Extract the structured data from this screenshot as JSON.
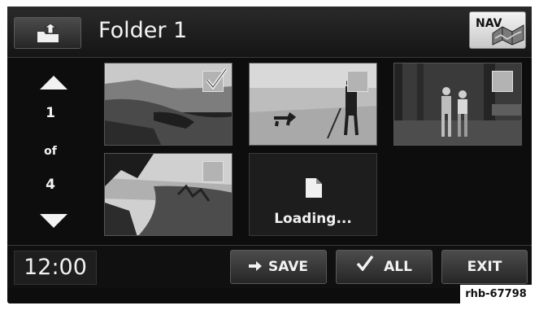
{
  "header": {
    "title": "Folder 1",
    "up_icon": "folder-up-icon",
    "nav_label": "NAV"
  },
  "pager": {
    "current": "1",
    "of": "of",
    "total": "4"
  },
  "thumbnails": [
    {
      "subject": "coastline landscape",
      "checked": true
    },
    {
      "subject": "person with dog on field",
      "checked": false
    },
    {
      "subject": "two people in forest",
      "checked": false
    },
    {
      "subject": "coastal cliffs with trees",
      "checked": false
    }
  ],
  "loading": {
    "label": "Loading...",
    "icon": "document-icon"
  },
  "footer": {
    "time": "12:00",
    "save_label": "SAVE",
    "save_icon": "arrow-right-icon",
    "all_label": "ALL",
    "all_icon": "checkmark-icon",
    "exit_label": "EXIT"
  },
  "watermark": "rhb-67798"
}
